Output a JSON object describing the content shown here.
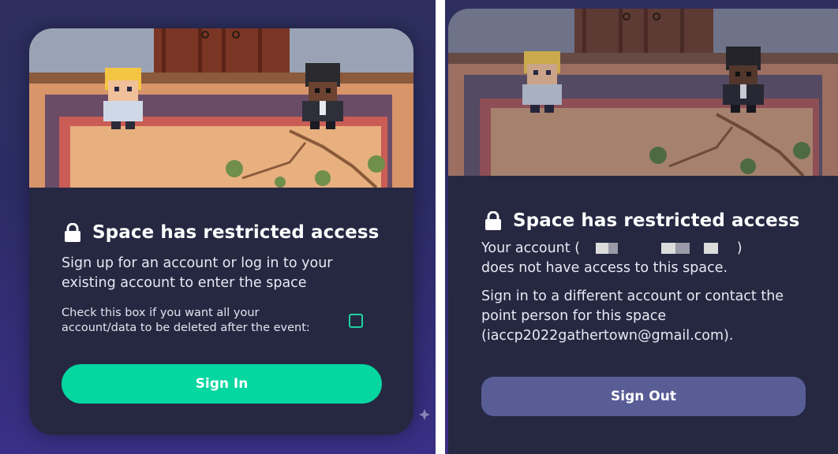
{
  "left_card": {
    "title": "Space has restricted access",
    "description": "Sign up for an account or log in to your existing account to enter the space",
    "checkbox_label": "Check this box if you want all your account/data to be deleted after the event:",
    "button_label": "Sign In",
    "lock_icon": "lock-icon"
  },
  "right_card": {
    "title": "Space has restricted access",
    "account_prefix": "Your account (",
    "account_suffix": ")",
    "no_access_text": "does not have access to this space.",
    "help_text": "Sign in to a different account or contact the point person for this space (iaccp2022gathertown@gmail.com).",
    "button_label": "Sign Out",
    "lock_icon": "lock-icon"
  },
  "colors": {
    "card_bg": "#262842",
    "sign_in_button": "#06d6a0",
    "sign_out_button": "#585d96",
    "checkbox_border": "#1fd1a3"
  }
}
